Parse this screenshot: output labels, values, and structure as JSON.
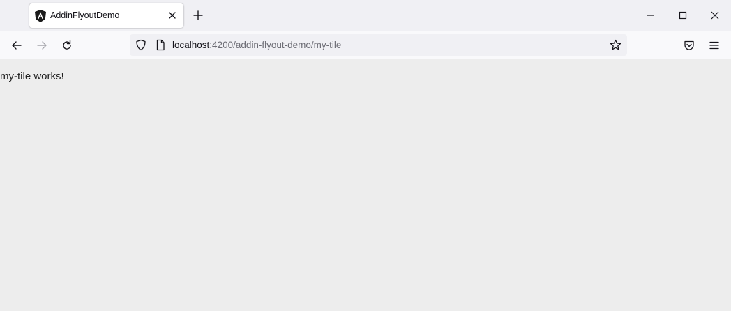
{
  "tab": {
    "title": "AddinFlyoutDemo",
    "favicon": "angular-logo-icon"
  },
  "window_controls": [
    "minimize-icon",
    "maximize-icon",
    "close-icon"
  ],
  "navigation": {
    "url_host": "localhost",
    "url_path": ":4200/addin-flyout-demo/my-tile",
    "icons": [
      "back-arrow-icon",
      "forward-arrow-icon",
      "reload-icon",
      "shield-icon",
      "page-icon",
      "star-icon",
      "pocket-icon",
      "menu-icon"
    ]
  },
  "page": {
    "text": "my-tile works!"
  },
  "colors": {
    "tabbar_bg": "#f0f0f4",
    "toolbar_bg": "#f9f9fb",
    "content_bg": "#ededed",
    "url_path": "#6d6d75"
  }
}
